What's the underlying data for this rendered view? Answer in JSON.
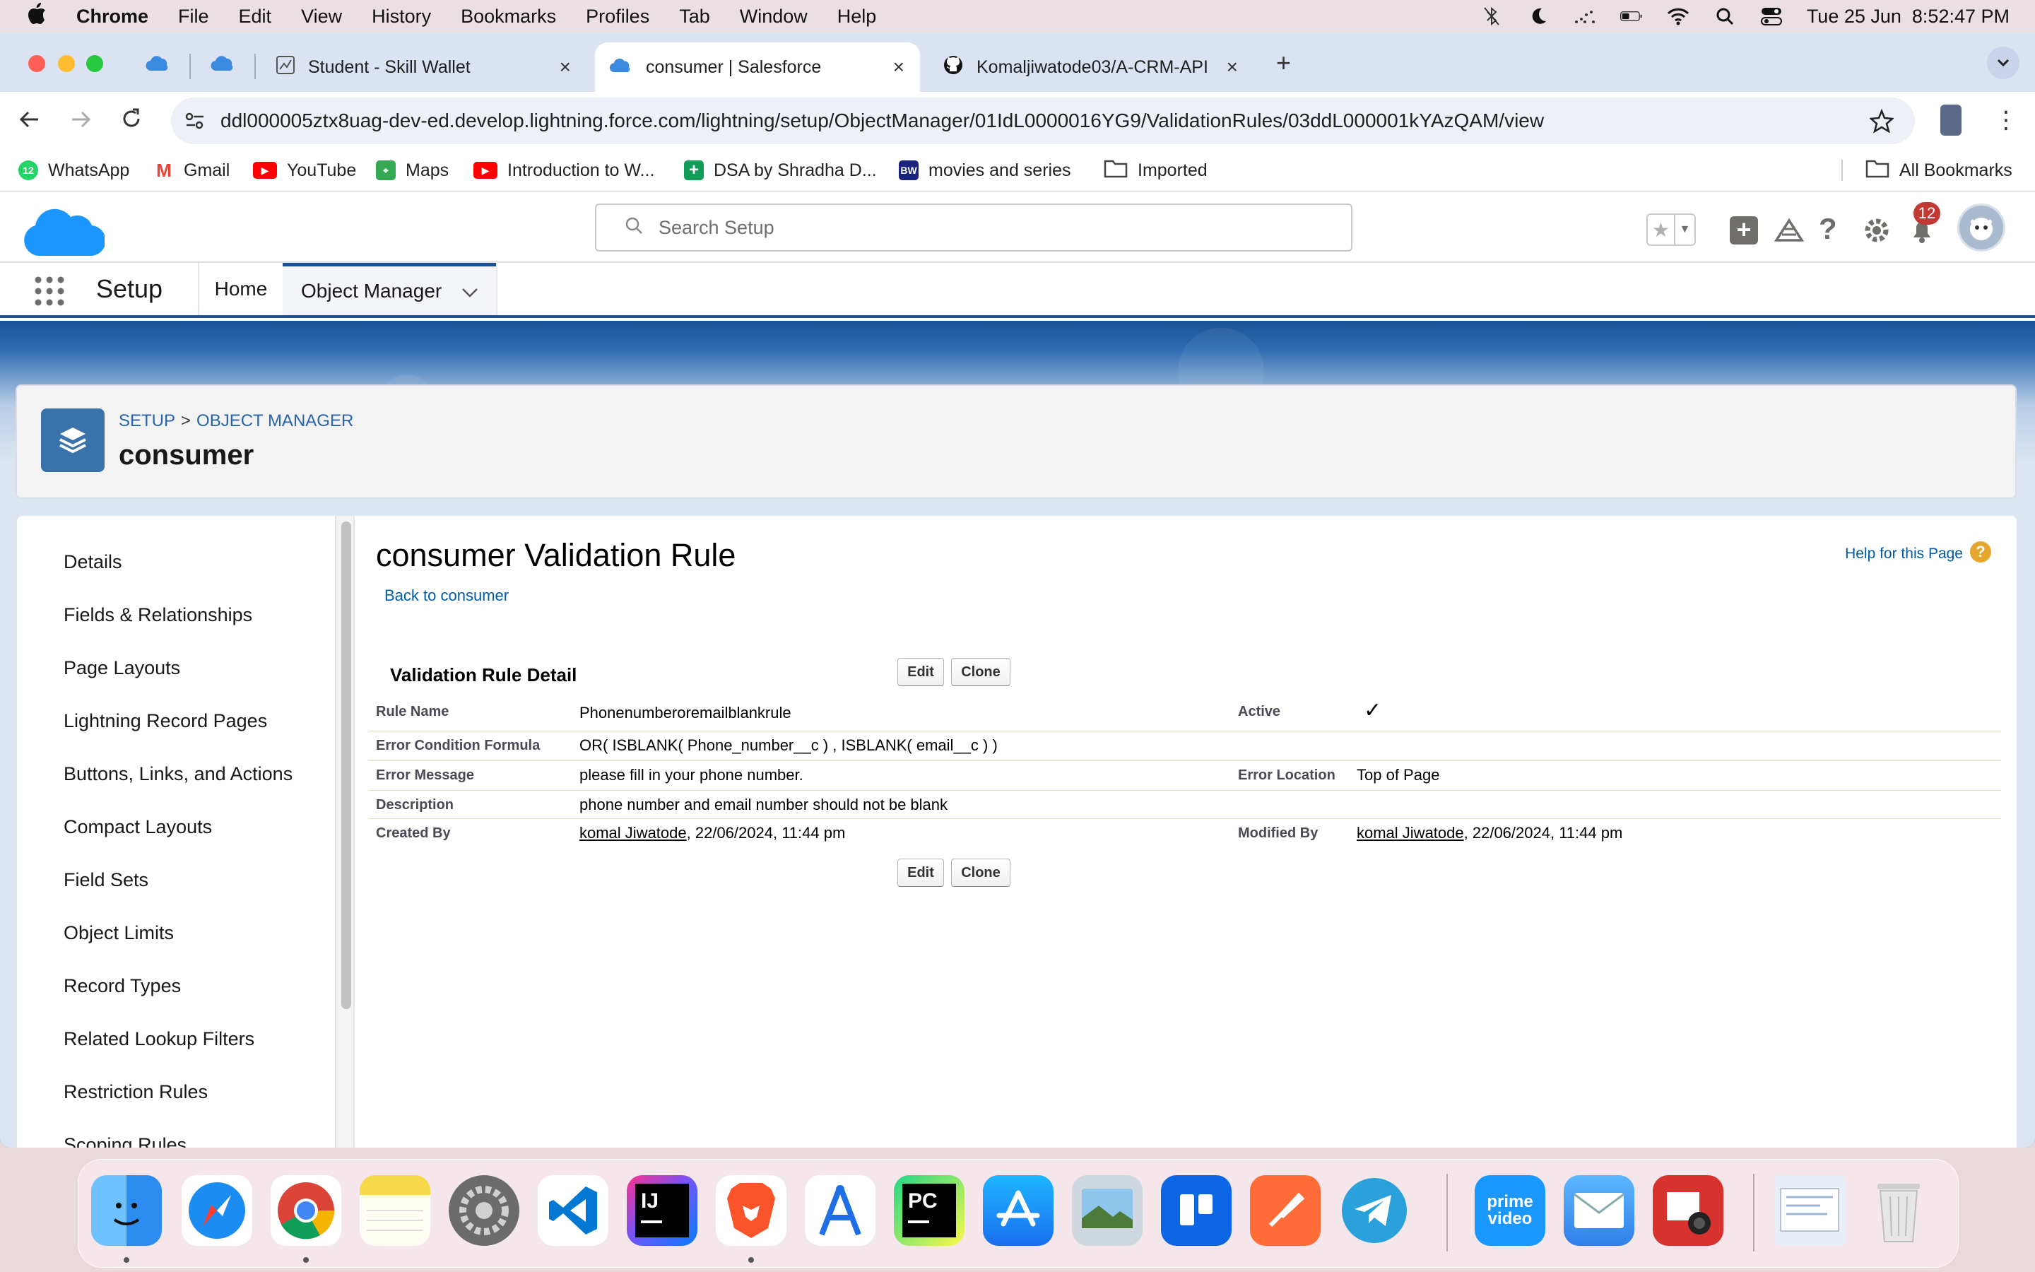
{
  "menubar": {
    "app": "Chrome",
    "items": [
      "File",
      "Edit",
      "View",
      "History",
      "Bookmarks",
      "Profiles",
      "Tab",
      "Window",
      "Help"
    ],
    "clock": "Tue 25 Jun  8:52:47 PM"
  },
  "browser": {
    "tabs": [
      {
        "title": "Student - Skill Wallet"
      },
      {
        "title": "consumer | Salesforce"
      },
      {
        "title": "Komaljiwatode03/A-CRM-API"
      }
    ],
    "new_tab": "+",
    "url": "ddl000005ztx8uag-dev-ed.develop.lightning.force.com/lightning/setup/ObjectManager/01IdL0000016YG9/ValidationRules/03ddL000001kYAzQAM/view",
    "bookmarks": [
      {
        "label": "WhatsApp",
        "color": "#25d366"
      },
      {
        "label": "Gmail",
        "color": "#ea4335"
      },
      {
        "label": "YouTube",
        "color": "#ff0000"
      },
      {
        "label": "Maps",
        "color": "#34a853"
      },
      {
        "label": "Introduction to W...",
        "color": "#ff0000"
      },
      {
        "label": "DSA by Shradha D...",
        "color": "#0f9d58"
      },
      {
        "label": "movies and series",
        "color": "#1a237e"
      },
      {
        "label": "Imported",
        "color": "#666666"
      }
    ],
    "all_bookmarks": "All Bookmarks"
  },
  "sf": {
    "search_placeholder": "Search Setup",
    "notification_count": "12",
    "app_name": "Setup",
    "nav": {
      "home": "Home",
      "object_manager": "Object Manager"
    },
    "breadcrumb": {
      "setup": "SETUP",
      "separator": ">",
      "object_manager": "OBJECT MANAGER"
    },
    "object_title": "consumer",
    "left_nav": [
      "Details",
      "Fields & Relationships",
      "Page Layouts",
      "Lightning Record Pages",
      "Buttons, Links, and Actions",
      "Compact Layouts",
      "Field Sets",
      "Object Limits",
      "Record Types",
      "Related Lookup Filters",
      "Restriction Rules",
      "Scoping Rules"
    ],
    "page_title": "consumer Validation Rule",
    "back_link": "Back to consumer",
    "help_link": "Help for this Page",
    "section_title": "Validation Rule Detail",
    "buttons": {
      "edit": "Edit",
      "clone": "Clone"
    },
    "fields": {
      "rule_name_label": "Rule Name",
      "rule_name": "Phonenumberoremailblankrule",
      "active_label": "Active",
      "active_check": "✓",
      "formula_label": "Error Condition Formula",
      "formula": "OR( ISBLANK( Phone_number__c ) , ISBLANK( email__c ) )",
      "error_message_label": "Error Message",
      "error_message": "please fill in your phone number.",
      "error_location_label": "Error Location",
      "error_location": "Top of Page",
      "description_label": "Description",
      "description": "phone number and email number should not be blank",
      "created_by_label": "Created By",
      "created_by_user": "komal Jiwatode",
      "created_by_date": ", 22/06/2024, 11:44 pm",
      "modified_by_label": "Modified By",
      "modified_by_user": "komal Jiwatode",
      "modified_by_date": ", 22/06/2024, 11:44 pm"
    }
  },
  "dock": {
    "apps": [
      {
        "name": "Finder",
        "color": "#2d8cf0"
      },
      {
        "name": "Safari",
        "color": "#1b8cf2"
      },
      {
        "name": "Chrome",
        "color": "#ffffff"
      },
      {
        "name": "Notes",
        "color": "#f7d84a"
      },
      {
        "name": "System Settings",
        "color": "#6b6b6b"
      },
      {
        "name": "VS Code",
        "color": "#ffffff"
      },
      {
        "name": "IntelliJ IDEA",
        "color": "#000000"
      },
      {
        "name": "Brave",
        "color": "#ffffff"
      },
      {
        "name": "Instruments",
        "color": "#ffffff"
      },
      {
        "name": "PyCharm",
        "color": "#000000"
      },
      {
        "name": "App Store",
        "color": "#1e90ff"
      },
      {
        "name": "Preview",
        "color": "#cfd8e0"
      },
      {
        "name": "Trello",
        "color": "#0c66e4"
      },
      {
        "name": "Postman",
        "color": "#ff6c37"
      },
      {
        "name": "Telegram",
        "color": "#2aa1da"
      },
      {
        "name": "Prime Video",
        "color": "#1a98ff"
      },
      {
        "name": "Mail",
        "color": "#3d95f5"
      },
      {
        "name": "Photo Booth",
        "color": "#d8322f"
      },
      {
        "name": "Downloads",
        "color": "#e8eef5"
      },
      {
        "name": "Trash",
        "color": "#d9d9d9"
      }
    ],
    "label_ij": "IJ",
    "label_pc": "PC",
    "label_prime": "prime video"
  }
}
